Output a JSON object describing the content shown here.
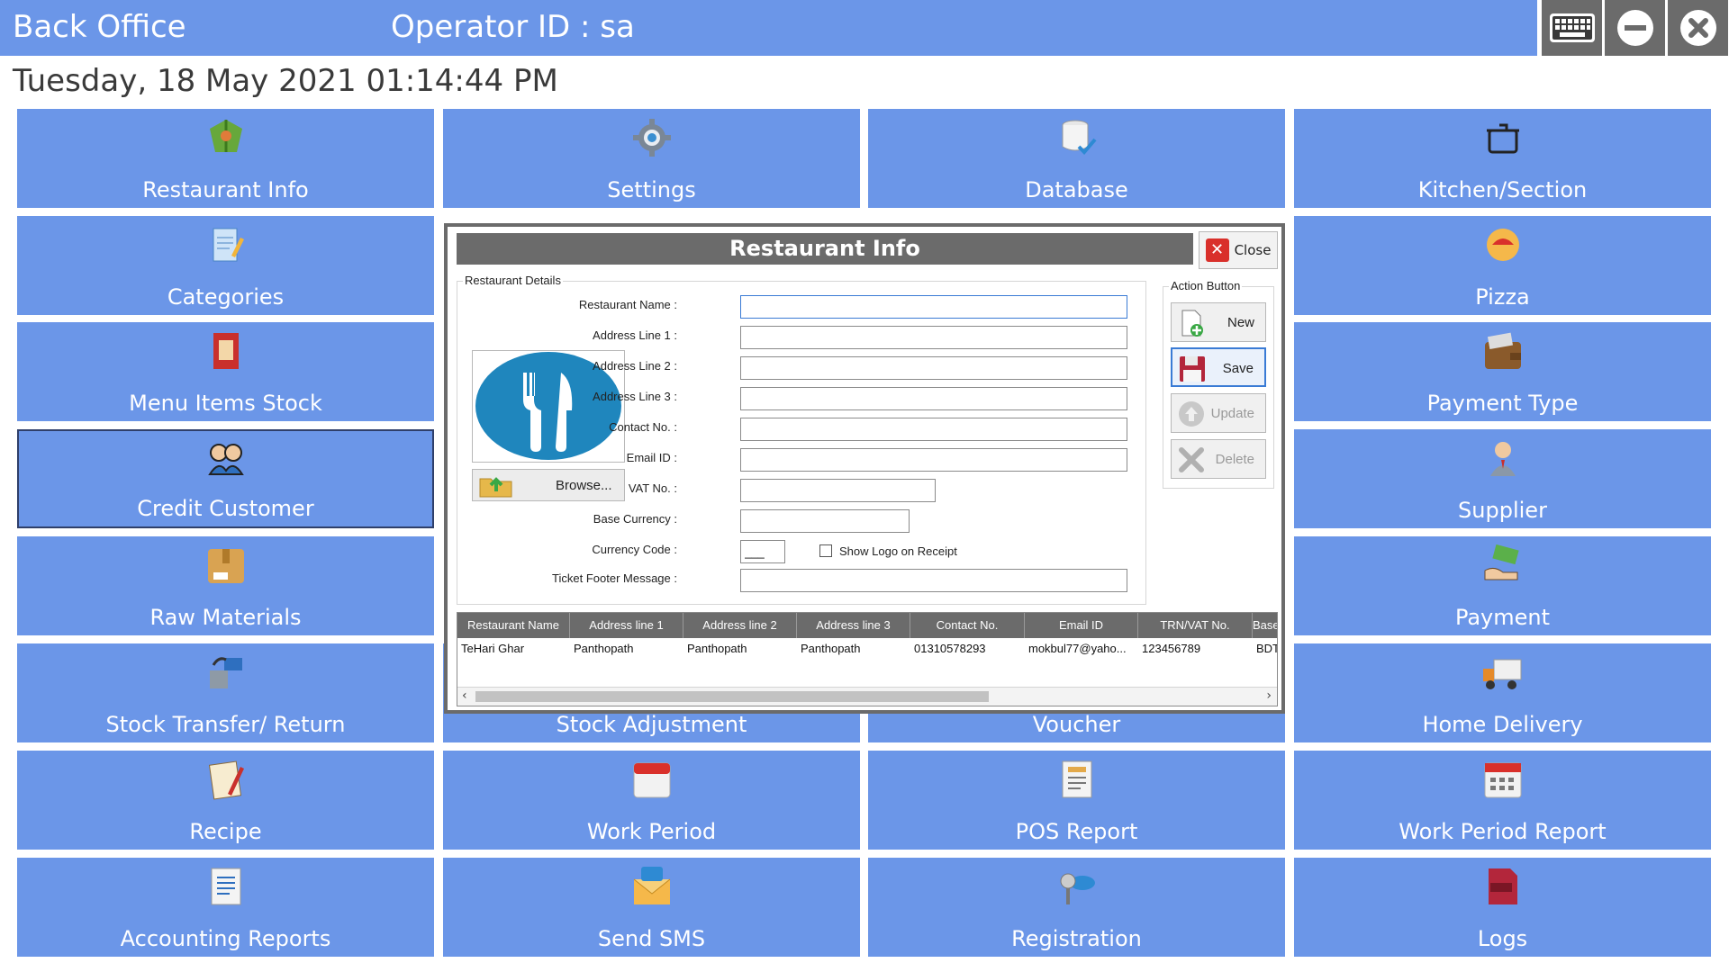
{
  "header": {
    "title": "Back Office",
    "operator": "Operator ID :  sa"
  },
  "datetime": "Tuesday, 18 May 2021 01:14:44 PM",
  "tiles": [
    {
      "label": "Restaurant Info"
    },
    {
      "label": "Settings"
    },
    {
      "label": "Database"
    },
    {
      "label": "Kitchen/Section"
    },
    {
      "label": "Categories"
    },
    {
      "label": ""
    },
    {
      "label": ""
    },
    {
      "label": "Pizza"
    },
    {
      "label": "Menu Items Stock"
    },
    {
      "label": ""
    },
    {
      "label": ""
    },
    {
      "label": "Payment Type"
    },
    {
      "label": "Credit Customer"
    },
    {
      "label": ""
    },
    {
      "label": ""
    },
    {
      "label": "Supplier"
    },
    {
      "label": "Raw Materials"
    },
    {
      "label": ""
    },
    {
      "label": ""
    },
    {
      "label": "Payment"
    },
    {
      "label": "Stock Transfer/ Return"
    },
    {
      "label": "Stock Adjustment"
    },
    {
      "label": "Voucher"
    },
    {
      "label": "Home Delivery"
    },
    {
      "label": "Recipe"
    },
    {
      "label": "Work Period"
    },
    {
      "label": "POS Report"
    },
    {
      "label": "Work Period Report"
    },
    {
      "label": "Accounting Reports"
    },
    {
      "label": "Send SMS"
    },
    {
      "label": "Registration"
    },
    {
      "label": "Logs"
    }
  ],
  "dialog": {
    "title": "Restaurant Info",
    "close_label": "Close",
    "details_group": "Restaurant Details",
    "browse_label": "Browse...",
    "fields": {
      "restaurant_name": {
        "label": "Restaurant Name :",
        "value": ""
      },
      "address1": {
        "label": "Address Line 1 :",
        "value": ""
      },
      "address2": {
        "label": "Address Line 2 :",
        "value": ""
      },
      "address3": {
        "label": "Address Line 3 :",
        "value": ""
      },
      "contact": {
        "label": "Contact No. :",
        "value": ""
      },
      "email": {
        "label": "Email ID :",
        "value": ""
      },
      "vat": {
        "label": "VAT No. :",
        "value": ""
      },
      "base_currency": {
        "label": "Base Currency :",
        "value": ""
      },
      "currency_code": {
        "label": "Currency Code :",
        "value": "___"
      },
      "ticket_footer": {
        "label": "Ticket Footer Message :",
        "value": ""
      }
    },
    "show_logo_label": "Show Logo on Receipt",
    "action_group": "Action Button",
    "actions": {
      "new": "New",
      "save": "Save",
      "update": "Update",
      "delete": "Delete"
    },
    "table": {
      "columns": [
        "Restaurant Name",
        "Address line 1",
        "Address line 2",
        "Address line 3",
        "Contact No.",
        "Email ID",
        "TRN/VAT No.",
        "Base"
      ],
      "rows": [
        [
          "TeHari Ghar",
          "Panthopath",
          "Panthopath",
          "Panthopath",
          "01310578293",
          "mokbul77@yaho...",
          "123456789",
          "BDT"
        ]
      ]
    }
  },
  "colors": {
    "tile": "#6b96e8",
    "header_gray": "#6b6b6b",
    "close_red": "#d9302b"
  },
  "icons": {
    "window": [
      "keyboard-icon",
      "minimize-icon",
      "close-icon"
    ],
    "tiles": [
      "restaurant-icon",
      "settings-gear-icon",
      "database-icon",
      "cooking-pot-icon",
      "notepad-icon",
      "",
      "",
      "pizza-icon",
      "menu-book-icon",
      "",
      "",
      "wallet-icon",
      "customers-icon",
      "",
      "",
      "supplier-person-icon",
      "box-icon",
      "",
      "",
      "money-hand-icon",
      "transfer-icon",
      "",
      "",
      "delivery-truck-icon",
      "recipe-icon",
      "calendar-icon",
      "report-icon",
      "calendar-report-icon",
      "document-icon",
      "sms-envelope-icon",
      "key-icon",
      "log-icon"
    ]
  }
}
